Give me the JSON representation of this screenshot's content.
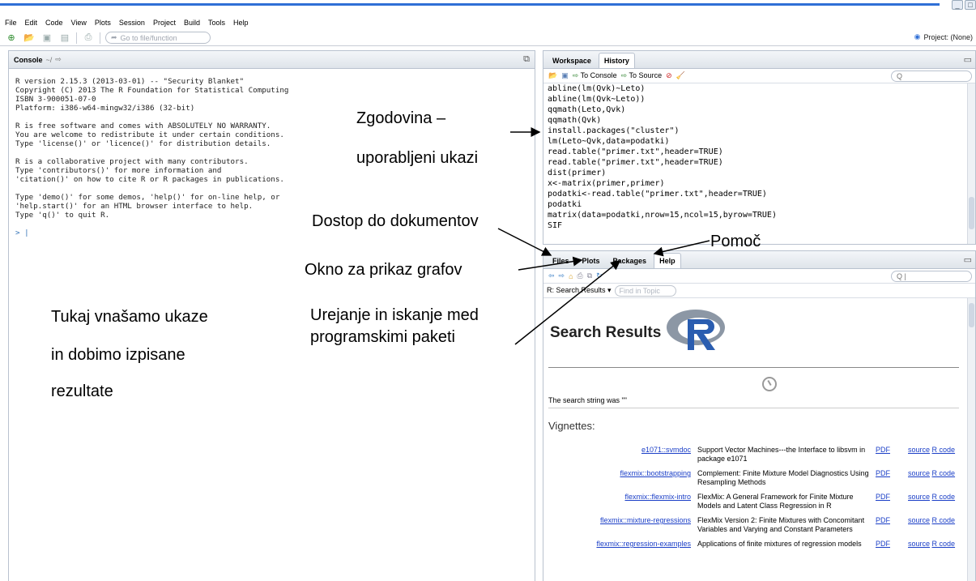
{
  "window_controls": [
    "_",
    "□"
  ],
  "menu": [
    "File",
    "Edit",
    "Code",
    "View",
    "Plots",
    "Session",
    "Project",
    "Build",
    "Tools",
    "Help"
  ],
  "toolbar": {
    "goto_placeholder": "Go to file/function",
    "project_label": "Project: (None)"
  },
  "console": {
    "title": "Console",
    "path": "~/",
    "lines": [
      "R version 2.15.3 (2013-03-01) -- \"Security Blanket\"",
      "Copyright (C) 2013 The R Foundation for Statistical Computing",
      "ISBN 3-900051-07-0",
      "Platform: i386-w64-mingw32/i386 (32-bit)",
      "",
      "R is free software and comes with ABSOLUTELY NO WARRANTY.",
      "You are welcome to redistribute it under certain conditions.",
      "Type 'license()' or 'licence()' for distribution details.",
      "",
      "R is a collaborative project with many contributors.",
      "Type 'contributors()' for more information and",
      "'citation()' on how to cite R or R packages in publications.",
      "",
      "Type 'demo()' for some demos, 'help()' for on-line help, or",
      "'help.start()' for an HTML browser interface to help.",
      "Type 'q()' to quit R.",
      ""
    ],
    "prompt": "> |"
  },
  "history_pane": {
    "tabs": [
      "Workspace",
      "History"
    ],
    "active_tab": "History",
    "to_console": "To Console",
    "to_source": "To Source",
    "search_placeholder": "Q",
    "entries": [
      "abline(lm(Qvk)~Leto)",
      "abline(lm(Qvk~Leto))",
      "qqmath(Leto,Qvk)",
      "qqmath(Qvk)",
      "install.packages(\"cluster\")",
      "lm(Leto~Qvk,data=podatki)",
      "read.table(\"primer.txt\",header=TRUE)",
      "read.table(\"primer.txt\",header=TRUE)",
      "dist(primer)",
      "x<-matrix(primer,primer)",
      "podatki<-read.table(\"primer.txt\",header=TRUE)",
      "podatki",
      "matrix(data=podatki,nrow=15,ncol=15,byrow=TRUE)",
      "SIF"
    ]
  },
  "help_pane": {
    "tabs": [
      "Files",
      "Plots",
      "Packages",
      "Help"
    ],
    "active_tab": "Help",
    "search_results_label": "R: Search Results ▾",
    "find_in_topic": "Find in Topic",
    "search_placeholder": "Q |",
    "title": "Search Results",
    "search_string": "The search string was \"\"",
    "vignettes_heading": "Vignettes:",
    "vignettes": [
      {
        "name": "e1071::svmdoc",
        "desc": "Support Vector Machines---the Interface to libsvm in package e1071",
        "pdf": "PDF",
        "source": "source",
        "rcode": "R code"
      },
      {
        "name": "flexmix::bootstrapping",
        "desc": "Complement: Finite Mixture Model Diagnostics Using Resampling Methods",
        "pdf": "PDF",
        "source": "source",
        "rcode": "R code"
      },
      {
        "name": "flexmix::flexmix-intro",
        "desc": "FlexMix: A General Framework for Finite Mixture Models and Latent Class Regression in R",
        "pdf": "PDF",
        "source": "source",
        "rcode": "R code"
      },
      {
        "name": "flexmix::mixture-regressions",
        "desc": "FlexMix Version 2: Finite Mixtures with Concomitant Variables and Varying and Constant Parameters",
        "pdf": "PDF",
        "source": "source",
        "rcode": "R code"
      },
      {
        "name": "flexmix::regression-examples",
        "desc": "Applications of finite mixtures of regression models",
        "pdf": "PDF",
        "source": "source",
        "rcode": "R code"
      }
    ]
  },
  "annotations": {
    "history": [
      "Zgodovina –",
      "uporabljeni ukazi"
    ],
    "documents": "Dostop do dokumentov",
    "help": "Pomoč",
    "plots": "Okno za prikaz grafov",
    "packages": [
      "Urejanje in iskanje med",
      "programskimi paketi"
    ],
    "console": [
      "Tukaj vnašamo ukaze",
      "in dobimo izpisane",
      "rezultate"
    ]
  },
  "colors": {
    "accent": "#2f6fd6",
    "link": "#1a3ec7",
    "pane_border": "#b9c2cf"
  }
}
